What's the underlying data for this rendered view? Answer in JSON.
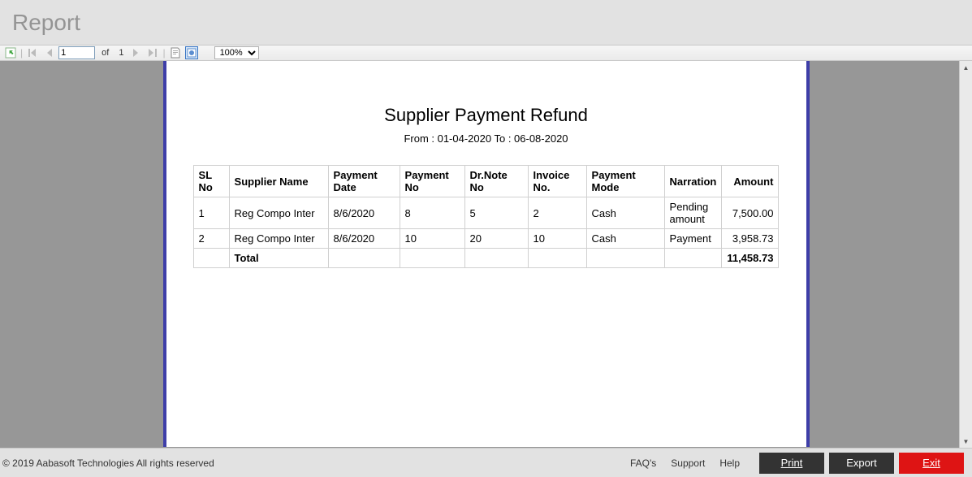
{
  "window": {
    "title": "Report"
  },
  "toolbar": {
    "page_current": "1",
    "of_label": "of",
    "page_total": "1",
    "zoom": "100%"
  },
  "report": {
    "title": "Supplier Payment Refund",
    "subtitle": "From : 01-04-2020 To : 06-08-2020",
    "columns": {
      "c0": "SL No",
      "c1": "Supplier Name",
      "c2": "Payment Date",
      "c3": "Payment No",
      "c4": "Dr.Note No",
      "c5": "Invoice No.",
      "c6": "Payment Mode",
      "c7": "Narration",
      "c8": "Amount"
    },
    "rows": [
      {
        "sl": "1",
        "supplier": "Reg Compo Inter",
        "date": "8/6/2020",
        "payno": "8",
        "drnote": "5",
        "invoice": "2",
        "mode": "Cash",
        "narration": "Pending amount",
        "amount": "7,500.00"
      },
      {
        "sl": "2",
        "supplier": "Reg Compo Inter",
        "date": "8/6/2020",
        "payno": "10",
        "drnote": "20",
        "invoice": "10",
        "mode": "Cash",
        "narration": "Payment",
        "amount": "3,958.73"
      }
    ],
    "total_label": "Total",
    "total_amount": "11,458.73"
  },
  "footer": {
    "copyright": "© 2019 Aabasoft Technologies All rights reserved",
    "faqs": "FAQ's",
    "support": "Support",
    "help": "Help",
    "print": "Print",
    "export": "Export",
    "exit": "Exit"
  }
}
